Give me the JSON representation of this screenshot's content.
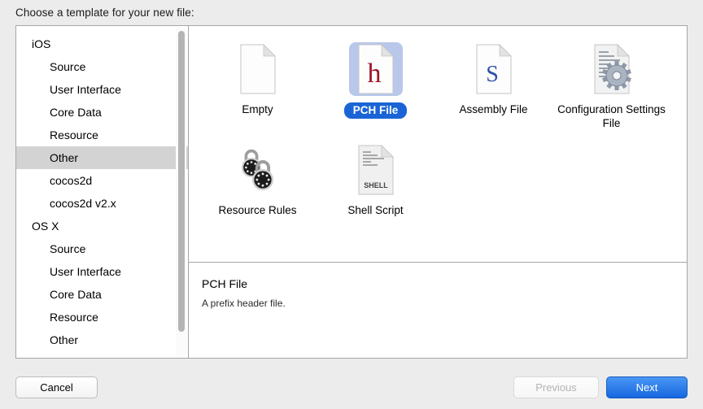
{
  "dialog": {
    "title": "Choose a template for your new file:"
  },
  "sidebar": {
    "items": [
      {
        "label": "iOS",
        "level": "group",
        "selected": false
      },
      {
        "label": "Source",
        "level": "child",
        "selected": false
      },
      {
        "label": "User Interface",
        "level": "child",
        "selected": false
      },
      {
        "label": "Core Data",
        "level": "child",
        "selected": false
      },
      {
        "label": "Resource",
        "level": "child",
        "selected": false
      },
      {
        "label": "Other",
        "level": "child",
        "selected": true
      },
      {
        "label": "cocos2d",
        "level": "child",
        "selected": false
      },
      {
        "label": "cocos2d v2.x",
        "level": "child",
        "selected": false
      },
      {
        "label": "OS X",
        "level": "group",
        "selected": false
      },
      {
        "label": "Source",
        "level": "child",
        "selected": false
      },
      {
        "label": "User Interface",
        "level": "child",
        "selected": false
      },
      {
        "label": "Core Data",
        "level": "child",
        "selected": false
      },
      {
        "label": "Resource",
        "level": "child",
        "selected": false
      },
      {
        "label": "Other",
        "level": "child",
        "selected": false
      }
    ]
  },
  "templates": [
    {
      "label": "Empty",
      "icon": "blank-document-icon",
      "selected": false
    },
    {
      "label": "PCH File",
      "icon": "header-file-h-icon",
      "selected": true
    },
    {
      "label": "Assembly File",
      "icon": "assembly-file-s-icon",
      "selected": false
    },
    {
      "label": "Configuration Settings File",
      "icon": "document-gear-icon",
      "selected": false
    },
    {
      "label": "Resource Rules",
      "icon": "padlocks-icon",
      "selected": false
    },
    {
      "label": "Shell Script",
      "icon": "shell-script-document-icon",
      "selected": false
    }
  ],
  "description": {
    "title": "PCH File",
    "body": "A prefix header file."
  },
  "buttons": {
    "cancel": "Cancel",
    "previous": "Previous",
    "next": "Next"
  },
  "colors": {
    "selection_blue": "#1a64d6",
    "selection_halo": "#b8c7ea",
    "sidebar_selection": "#d3d3d3",
    "next_button": "#1667e0",
    "window_background": "#ececec"
  }
}
